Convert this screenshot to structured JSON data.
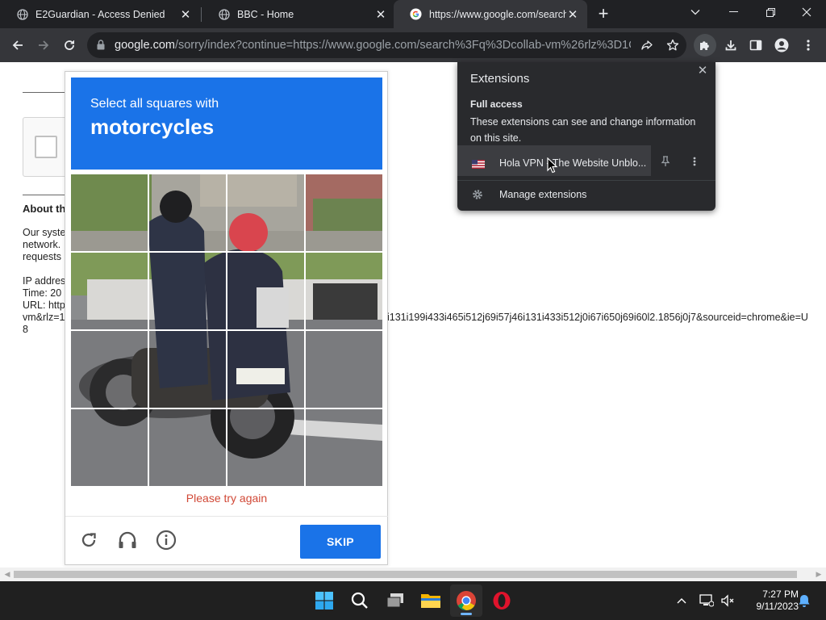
{
  "tabs": [
    {
      "title": "E2Guardian - Access Denied",
      "favicon": "globe-icon",
      "active": false
    },
    {
      "title": "BBC - Home",
      "favicon": "globe-icon",
      "active": false
    },
    {
      "title": "https://www.google.com/search?",
      "favicon": "google-icon",
      "active": true
    }
  ],
  "address_bar": {
    "host": "google.com",
    "path": "/sorry/index?continue=https://www.google.com/search%3Fq%3Dcollab-vm%26rlz%3D1C..."
  },
  "page": {
    "heading": "About th",
    "paragraph_lines": [
      "Our syste",
      "network.",
      "requests"
    ],
    "ip_label": "IP addres",
    "time_label": "Time: 20",
    "url_label": "URL: http",
    "url_line2": "vm&rlz=1",
    "url_line3": "8",
    "url_tail": "i131i199i433i465i512j69i57j46i131i433i512j0i67i650j69i60l2.1856j0j7&sourceid=chrome&ie=U"
  },
  "captcha": {
    "instruction": "Select all squares with",
    "target": "motorcycles",
    "error": "Please try again",
    "skip_label": "SKIP",
    "tiles": 16
  },
  "extensions_popup": {
    "title": "Extensions",
    "section": "Full access",
    "description": "These extensions can see and change information on this site.",
    "extension_name": "Hola VPN - The Website Unblo...",
    "manage_label": "Manage extensions"
  },
  "taskbar": {
    "time": "7:27 PM",
    "date": "9/11/2023"
  },
  "colors": {
    "captcha_blue": "#1a73e8",
    "error_red": "#d14836",
    "chrome_dark": "#202124",
    "popup_bg": "#292a2d"
  }
}
